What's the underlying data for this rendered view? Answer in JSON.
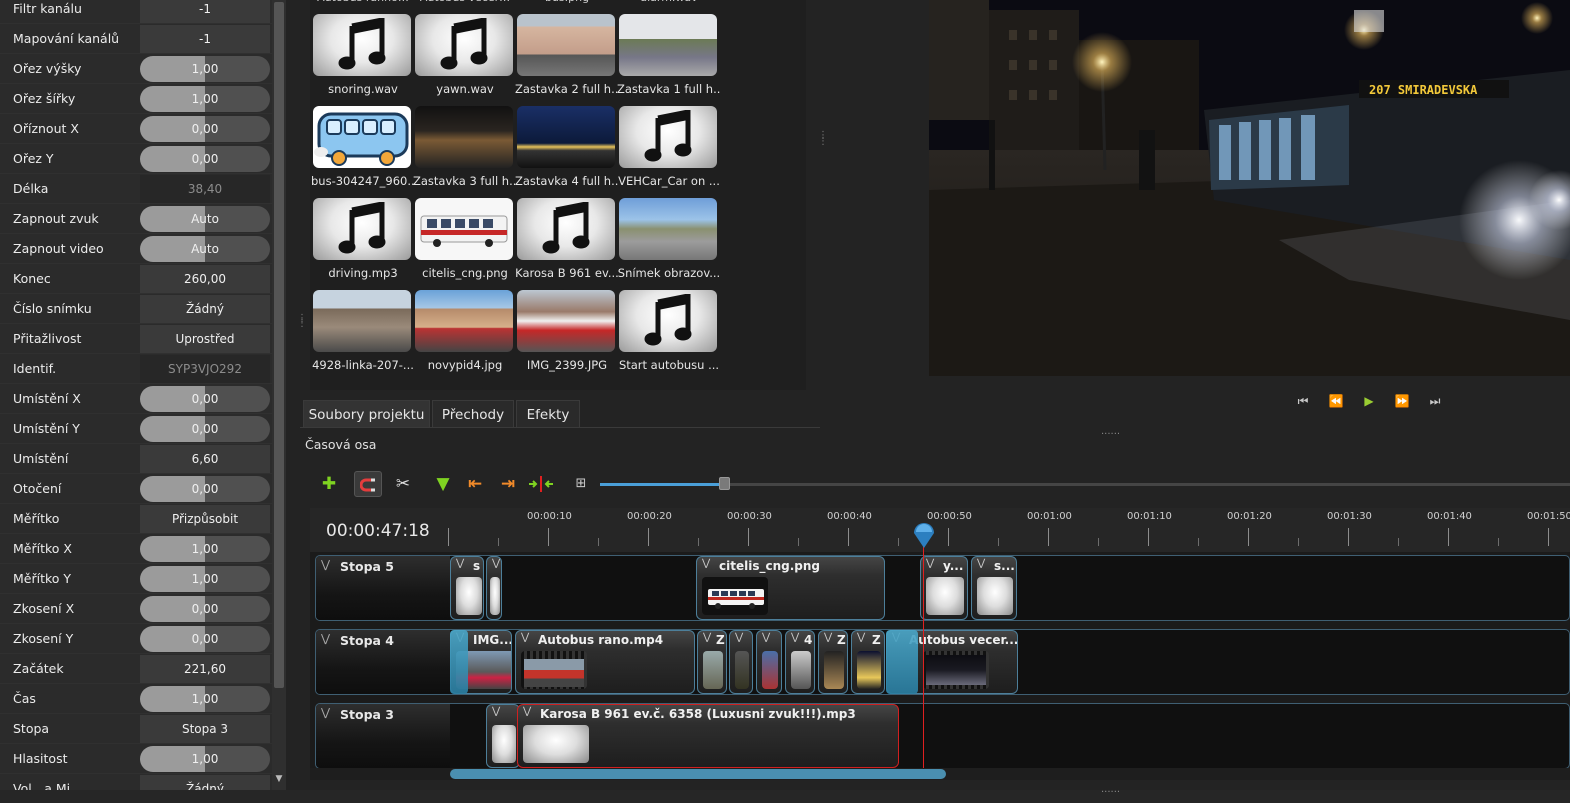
{
  "properties": [
    {
      "label": "Filtr kanálu",
      "value": "-1",
      "kind": "cell"
    },
    {
      "label": "Mapování kanálů",
      "value": "-1",
      "kind": "cell"
    },
    {
      "label": "Ořez výšky",
      "value": "1,00",
      "kind": "pill"
    },
    {
      "label": "Ořez šířky",
      "value": "1,00",
      "kind": "pill"
    },
    {
      "label": "Oříznout X",
      "value": "0,00",
      "kind": "pill"
    },
    {
      "label": "Ořez Y",
      "value": "0,00",
      "kind": "pill"
    },
    {
      "label": "Délka",
      "value": "38,40",
      "kind": "ro"
    },
    {
      "label": "Zapnout zvuk",
      "value": "Auto",
      "kind": "pill"
    },
    {
      "label": "Zapnout video",
      "value": "Auto",
      "kind": "pill"
    },
    {
      "label": "Konec",
      "value": "260,00",
      "kind": "cell"
    },
    {
      "label": "Číslo snímku",
      "value": "Žádný",
      "kind": "cell"
    },
    {
      "label": "Přitažlivost",
      "value": "Uprostřed",
      "kind": "cell"
    },
    {
      "label": "Identif.",
      "value": "SYP3VJO292",
      "kind": "ro"
    },
    {
      "label": "Umístění X",
      "value": "0,00",
      "kind": "pill"
    },
    {
      "label": "Umístění Y",
      "value": "0,00",
      "kind": "pill"
    },
    {
      "label": "Umístění",
      "value": "6,60",
      "kind": "cell"
    },
    {
      "label": "Otočení",
      "value": "0,00",
      "kind": "pill"
    },
    {
      "label": "Měřítko",
      "value": "Přizpůsobit",
      "kind": "cell"
    },
    {
      "label": "Měřítko X",
      "value": "1,00",
      "kind": "pill"
    },
    {
      "label": "Měřítko Y",
      "value": "1,00",
      "kind": "pill"
    },
    {
      "label": "Zkosení X",
      "value": "0,00",
      "kind": "pill"
    },
    {
      "label": "Zkosení Y",
      "value": "0,00",
      "kind": "pill"
    },
    {
      "label": "Začátek",
      "value": "221,60",
      "kind": "cell"
    },
    {
      "label": "Čas",
      "value": "1,00",
      "kind": "pill"
    },
    {
      "label": "Stopa",
      "value": "Stopa 3",
      "kind": "cell"
    },
    {
      "label": "Hlasitost",
      "value": "1,00",
      "kind": "pill"
    },
    {
      "label": "Vol…a Mi…",
      "value": "Žádný",
      "kind": "cell"
    }
  ],
  "files": {
    "top_partial": [
      "Autobus ranno…",
      "Autobus vecer…",
      "bus.png",
      "alarm.wav"
    ],
    "items": [
      {
        "name": "snoring.wav",
        "type": "audio"
      },
      {
        "name": "yawn.wav",
        "type": "audio"
      },
      {
        "name": "Zastavka 2 full h...",
        "type": "image",
        "scene": "street"
      },
      {
        "name": "Zastavka 1 full h...",
        "type": "image",
        "scene": "parking"
      },
      {
        "name": "bus-304247_960...",
        "type": "image",
        "scene": "cartoon"
      },
      {
        "name": "Zastavka 3 full h...",
        "type": "image",
        "scene": "station"
      },
      {
        "name": "Zastavka 4 full h...",
        "type": "image",
        "scene": "night"
      },
      {
        "name": "VEHCar_Car on ...",
        "type": "audio"
      },
      {
        "name": "driving.mp3",
        "type": "audio"
      },
      {
        "name": "citelis_cng.png",
        "type": "image",
        "scene": "bus"
      },
      {
        "name": "Karosa B 961 ev...",
        "type": "audio"
      },
      {
        "name": "Snímek obrazov...",
        "type": "image",
        "scene": "road"
      },
      {
        "name": "4928-linka-207-...",
        "type": "image",
        "scene": "city"
      },
      {
        "name": "novypid4.jpg",
        "type": "image",
        "scene": "tram"
      },
      {
        "name": "IMG_2399.JPG",
        "type": "image",
        "scene": "busstreet"
      },
      {
        "name": "Start autobusu ...",
        "type": "audio"
      }
    ]
  },
  "tabs": [
    {
      "label": "Soubory projektu",
      "active": true
    },
    {
      "label": "Přechody",
      "active": false
    },
    {
      "label": "Efekty",
      "active": false
    }
  ],
  "timeline": {
    "title": "Časová osa",
    "timecode": "00:00:47:18",
    "ticks": [
      "00:00:10",
      "00:00:20",
      "00:00:30",
      "00:00:40",
      "00:00:50",
      "00:01:00",
      "00:01:10",
      "00:01:20",
      "00:01:30",
      "00:01:40",
      "00:01:50"
    ],
    "tracks": [
      {
        "name": "Stopa 5"
      },
      {
        "name": "Stopa 4"
      },
      {
        "name": "Stopa 3"
      }
    ],
    "clips": {
      "t5": [
        "s",
        "",
        "citelis_cng.png",
        "y...",
        "s..."
      ],
      "t4": [
        "IMG...",
        "Autobus rano.mp4",
        "Z",
        "",
        "",
        "4",
        "Z",
        "Z",
        "Autobus vecer...."
      ],
      "t3": [
        "",
        "Karosa B 961 ev.č. 6358 (Luxusni zvuk!!!).mp3"
      ]
    }
  },
  "preview": {
    "bus_sign": "207 SMIRADEVSKA"
  },
  "colors": {
    "accent": "#4a9fd8",
    "playhead": "#e02020",
    "clip_border": "#4d7f9a",
    "selected_clip_border": "#d02020"
  }
}
